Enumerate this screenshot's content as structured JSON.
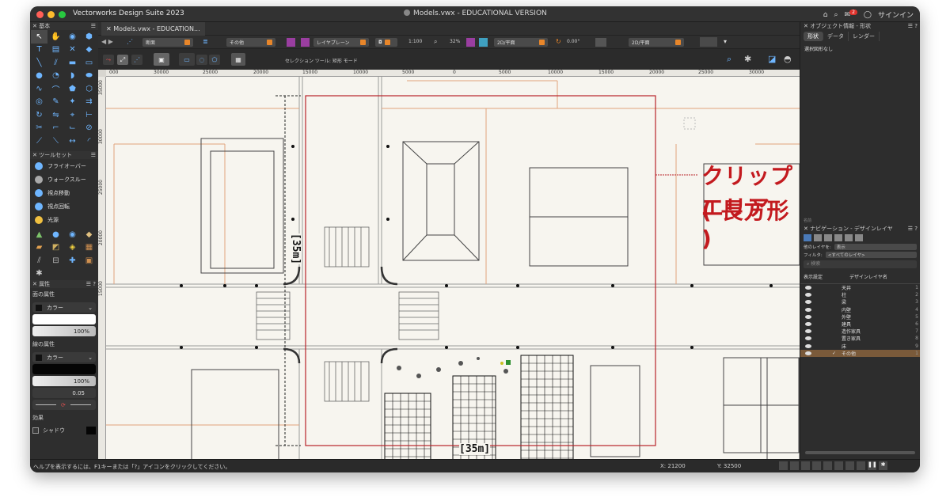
{
  "window": {
    "app_title": "Vectorworks Design Suite 2023",
    "doc_title": "Models.vwx - EDUCATIONAL VERSION",
    "sign_in": "サインイン",
    "notification_count": "2"
  },
  "basic_palette": {
    "title": "基本"
  },
  "toolset_palette": {
    "title": "ツールセット",
    "items": [
      "フライオーバー",
      "ウォークスルー",
      "視点移動",
      "視点回転",
      "光源"
    ]
  },
  "attributes_palette": {
    "title": "属性",
    "fill_label": "面の属性",
    "fill_type": "カラー",
    "fill_opacity": "100%",
    "line_label": "線の属性",
    "line_type": "カラー",
    "line_opacity": "100%",
    "line_weight": "0.05",
    "effects_label": "効果",
    "shadow_label": "シャドウ"
  },
  "toolbar": {
    "doc_tab": "Models.vwx - EDUCATION...",
    "view_dropdown": "断面",
    "class_dropdown": "その他",
    "plane_dropdown": "レイヤプレーン",
    "scale": "1:100",
    "zoom": "32%",
    "view_mode_1": "2D/平面",
    "angle": "0.00°",
    "view_mode_2": "2D/平面"
  },
  "mode_bar": {
    "hint": "セレクション ツール: 矩形 モード"
  },
  "rulers": {
    "h_ticks": [
      "000",
      "30000",
      "25000",
      "20000",
      "15000",
      "10000",
      "5000",
      "0",
      "5000",
      "10000",
      "15000",
      "20000",
      "25000",
      "30000"
    ],
    "v_ticks": [
      "35000",
      "30000",
      "25000",
      "20000",
      "15000"
    ]
  },
  "canvas": {
    "annotation_line1": "クリップエリア",
    "annotation_line2": "( 長方形 )",
    "dim_vertical": "[35m]",
    "dim_horizontal": "[35m]"
  },
  "status": {
    "help": "ヘルプを表示するには、F1キーまたは「?」アイコンをクリックしてください。",
    "x": "X: 21200",
    "y": "Y: 32500"
  },
  "object_info": {
    "title": "オブジェクト情報 - 形状",
    "tabs": [
      "形状",
      "データ",
      "レンダー"
    ],
    "no_selection": "選択図形なし",
    "footer": "名前"
  },
  "navigation": {
    "title": "ナビゲーション - デザインレイヤ",
    "other_layers_label": "他のレイヤを:",
    "other_layers_value": "表示",
    "filter_label": "フィルタ:",
    "filter_value": "<すべてのレイヤ>",
    "search_placeholder": "検索",
    "col_visibility": "表示設定",
    "col_layer": "デザインレイヤ名",
    "layers": [
      {
        "name": "天井",
        "num": "1"
      },
      {
        "name": "柱",
        "num": "2"
      },
      {
        "name": "梁",
        "num": "3"
      },
      {
        "name": "内壁",
        "num": "4"
      },
      {
        "name": "外壁",
        "num": "5"
      },
      {
        "name": "建具",
        "num": "6"
      },
      {
        "name": "造作家具",
        "num": "7"
      },
      {
        "name": "置き家具",
        "num": "8"
      },
      {
        "name": "床",
        "num": "9"
      },
      {
        "name": "その他",
        "num": "1",
        "active": true
      }
    ]
  },
  "colors": {
    "accent_blue": "#6fb6ff",
    "annotation_red": "#c31a1f",
    "dropdown_orange": "#e8862a",
    "canvas_bg": "#f7f5ef"
  }
}
